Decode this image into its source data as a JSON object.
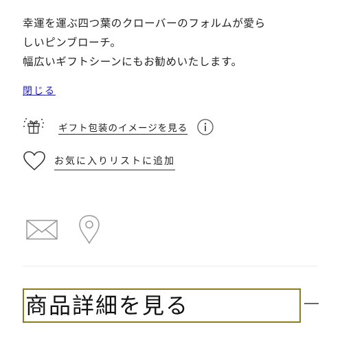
{
  "description": {
    "line1": "幸運を運ぶ四つ葉のクローバーのフォルムが愛ら",
    "line2": "しいピンブローチ。",
    "line3": "幅広いギフトシーンにもお勧めいたします。"
  },
  "close_link": "閉じる",
  "gift_wrap": {
    "label": "ギフト包装のイメージを見る",
    "icon": "gift-icon",
    "info_icon": "info-icon"
  },
  "favorite": {
    "label": "お気に入りリストに追加",
    "icon": "heart-icon"
  },
  "share_icons": [
    "mail-icon",
    "location-pin-icon"
  ],
  "details": {
    "label": "商品詳細を見る",
    "toggle_icon": "minus-icon"
  },
  "colors": {
    "link": "#1a1aa6",
    "focus_border": "#8c7a1e",
    "divider": "#ececec"
  }
}
